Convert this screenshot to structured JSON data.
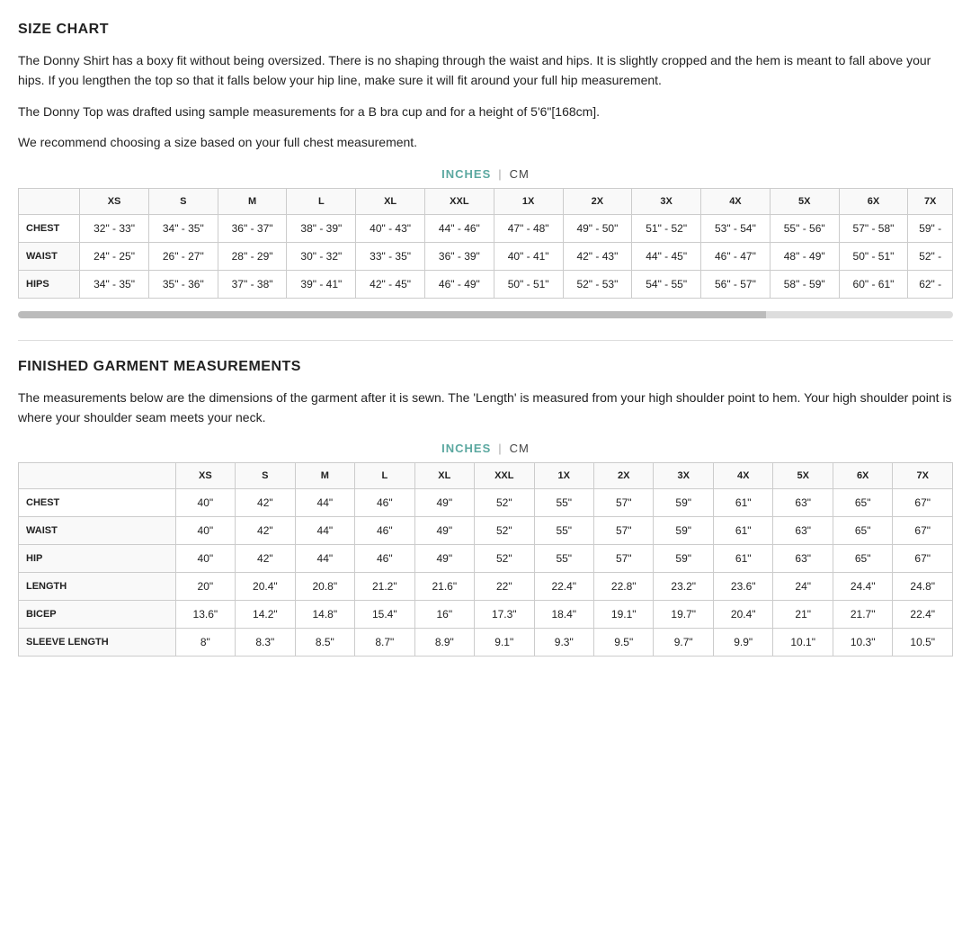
{
  "page": {
    "title1": "SIZE CHART",
    "desc1": "The Donny Shirt has a boxy fit without being oversized. There is no shaping through the waist and hips. It is slightly cropped and the hem is meant to fall above your hips. If you lengthen the top so that it falls below your hip line, make sure it will fit around your full hip measurement.",
    "desc2": "The Donny Top was drafted using sample measurements for a B bra cup and for a height of 5'6\"[168cm].",
    "desc3": "We recommend choosing a size based on your full chest measurement.",
    "unit_inches": "INCHES",
    "unit_cm": "CM",
    "table1": {
      "columns": [
        "",
        "XS",
        "S",
        "M",
        "L",
        "XL",
        "XXL",
        "1X",
        "2X",
        "3X",
        "4X",
        "5X",
        "6X",
        "7X"
      ],
      "rows": [
        [
          "CHEST",
          "32\" - 33\"",
          "34\" - 35\"",
          "36\" - 37\"",
          "38\" - 39\"",
          "40\" - 43\"",
          "44\" - 46\"",
          "47\" - 48\"",
          "49\" - 50\"",
          "51\" - 52\"",
          "53\" - 54\"",
          "55\" - 56\"",
          "57\" - 58\"",
          "59\" -"
        ],
        [
          "WAIST",
          "24\" - 25\"",
          "26\" - 27\"",
          "28\" - 29\"",
          "30\" - 32\"",
          "33\" - 35\"",
          "36\" - 39\"",
          "40\" - 41\"",
          "42\" - 43\"",
          "44\" - 45\"",
          "46\" - 47\"",
          "48\" - 49\"",
          "50\" - 51\"",
          "52\" -"
        ],
        [
          "HIPS",
          "34\" - 35\"",
          "35\" - 36\"",
          "37\" - 38\"",
          "39\" - 41\"",
          "42\" - 45\"",
          "46\" - 49\"",
          "50\" - 51\"",
          "52\" - 53\"",
          "54\" - 55\"",
          "56\" - 57\"",
          "58\" - 59\"",
          "60\" - 61\"",
          "62\" -"
        ]
      ]
    },
    "title2": "FINISHED GARMENT MEASUREMENTS",
    "desc4": "The measurements below are the dimensions of the garment after it is sewn. The 'Length' is measured from your high shoulder point to hem. Your high shoulder point is where your shoulder seam meets your neck.",
    "table2": {
      "columns": [
        "",
        "XS",
        "S",
        "M",
        "L",
        "XL",
        "XXL",
        "1X",
        "2X",
        "3X",
        "4X",
        "5X",
        "6X",
        "7X"
      ],
      "rows": [
        [
          "CHEST",
          "40\"",
          "42\"",
          "44\"",
          "46\"",
          "49\"",
          "52\"",
          "55\"",
          "57\"",
          "59\"",
          "61\"",
          "63\"",
          "65\"",
          "67\""
        ],
        [
          "WAIST",
          "40\"",
          "42\"",
          "44\"",
          "46\"",
          "49\"",
          "52\"",
          "55\"",
          "57\"",
          "59\"",
          "61\"",
          "63\"",
          "65\"",
          "67\""
        ],
        [
          "HIP",
          "40\"",
          "42\"",
          "44\"",
          "46\"",
          "49\"",
          "52\"",
          "55\"",
          "57\"",
          "59\"",
          "61\"",
          "63\"",
          "65\"",
          "67\""
        ],
        [
          "LENGTH",
          "20\"",
          "20.4\"",
          "20.8\"",
          "21.2\"",
          "21.6\"",
          "22\"",
          "22.4\"",
          "22.8\"",
          "23.2\"",
          "23.6\"",
          "24\"",
          "24.4\"",
          "24.8\""
        ],
        [
          "BICEP",
          "13.6\"",
          "14.2\"",
          "14.8\"",
          "15.4\"",
          "16\"",
          "17.3\"",
          "18.4\"",
          "19.1\"",
          "19.7\"",
          "20.4\"",
          "21\"",
          "21.7\"",
          "22.4\""
        ],
        [
          "SLEEVE LENGTH",
          "8\"",
          "8.3\"",
          "8.5\"",
          "8.7\"",
          "8.9\"",
          "9.1\"",
          "9.3\"",
          "9.5\"",
          "9.7\"",
          "9.9\"",
          "10.1\"",
          "10.3\"",
          "10.5\""
        ]
      ]
    }
  }
}
